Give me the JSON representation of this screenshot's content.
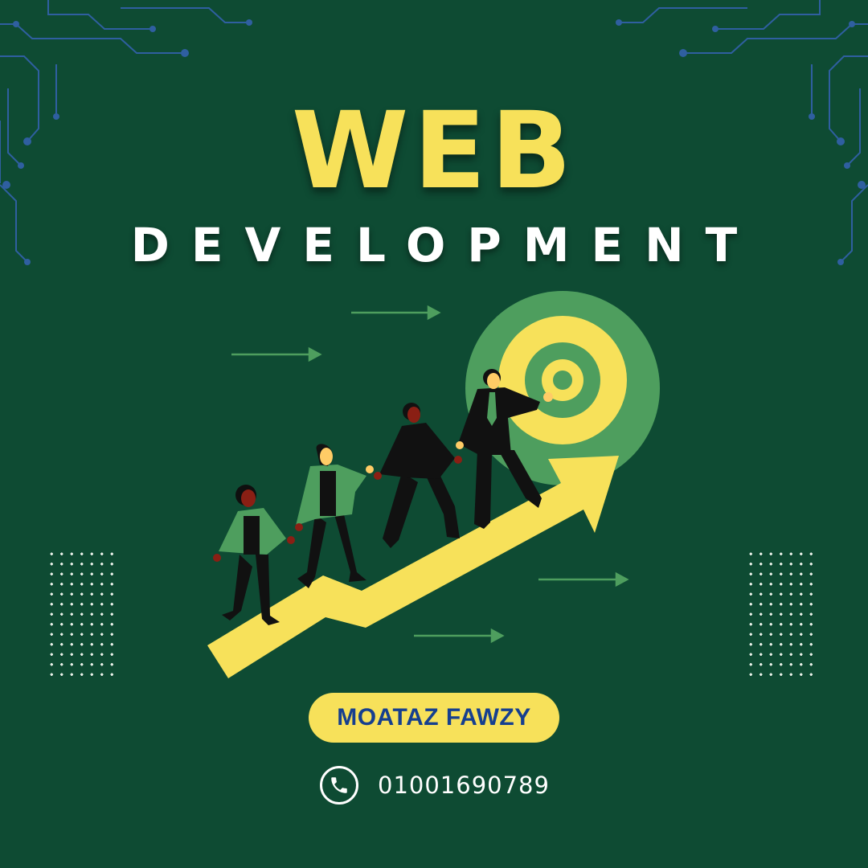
{
  "title": {
    "main": "WEB",
    "sub": "DEVELOPMENT"
  },
  "author": {
    "name": "MOATAZ FAWZY"
  },
  "contact": {
    "phone": "01001690789",
    "icon": "phone-icon"
  },
  "colors": {
    "background": "#0e4b33",
    "accent_yellow": "#f7e15a",
    "accent_green": "#4e9e5e",
    "circuit_blue": "#2f5fa0",
    "name_text": "#163f8f"
  },
  "illustration": {
    "subject": "businesspeople-climbing-growth-arrow-toward-target"
  }
}
